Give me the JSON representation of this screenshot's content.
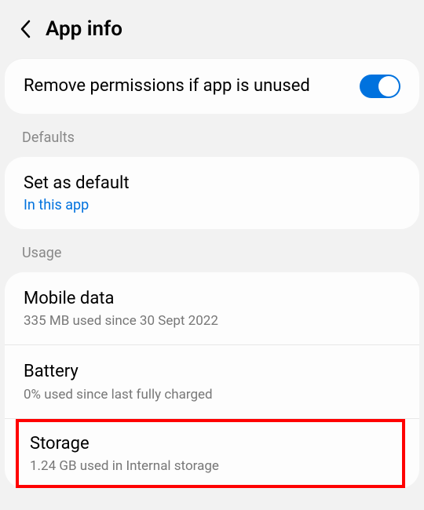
{
  "header": {
    "title": "App info"
  },
  "permissions": {
    "title": "Remove permissions if app is unused"
  },
  "sections": {
    "defaults": "Defaults",
    "usage": "Usage"
  },
  "defaults": {
    "title": "Set as default",
    "sub": "In this app"
  },
  "mobileData": {
    "title": "Mobile data",
    "sub": "335 MB used since 30 Sept 2022"
  },
  "battery": {
    "title": "Battery",
    "sub": "0% used since last fully charged"
  },
  "storage": {
    "title": "Storage",
    "sub": "1.24 GB used in Internal storage"
  }
}
